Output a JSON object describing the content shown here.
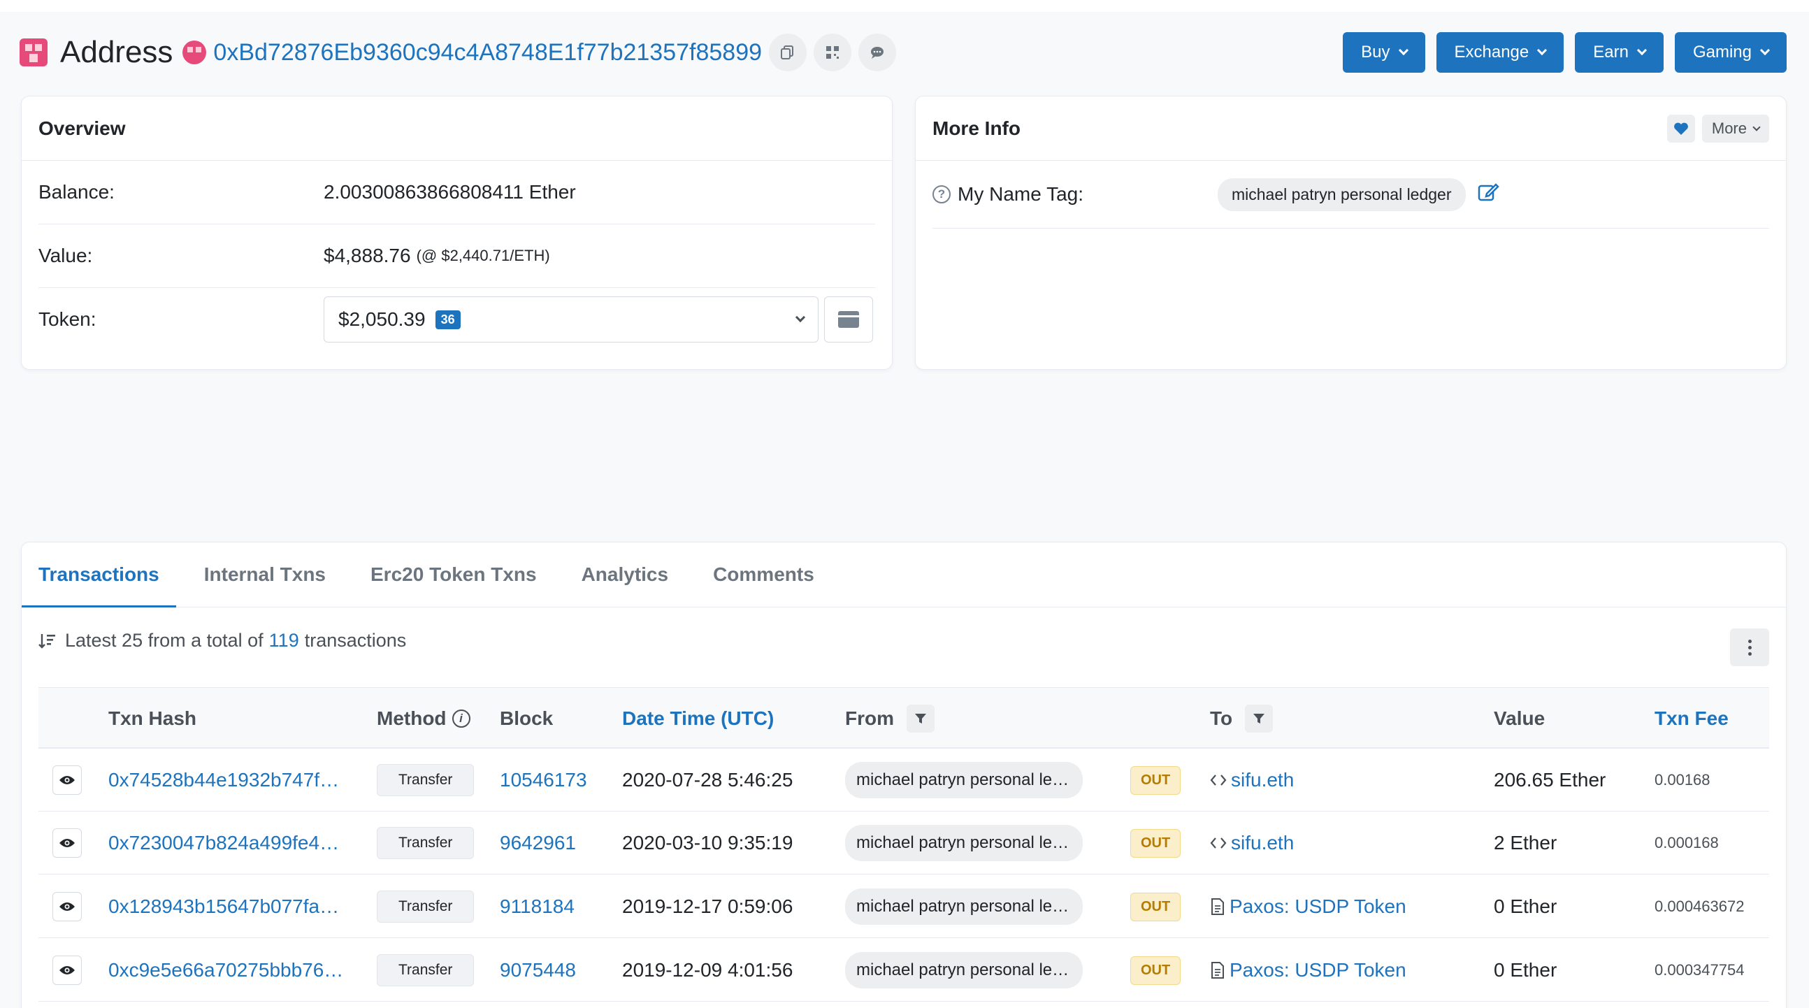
{
  "header": {
    "title": "Address",
    "address": "0xBd72876Eb9360c94c4A8748E1f77b21357f85899",
    "buttons": [
      {
        "label": "Buy"
      },
      {
        "label": "Exchange"
      },
      {
        "label": "Earn"
      },
      {
        "label": "Gaming"
      }
    ]
  },
  "overview": {
    "title": "Overview",
    "balance_label": "Balance:",
    "balance_value": "2.00300863866808411 Ether",
    "value_label": "Value:",
    "value_usd": "$4,888.76",
    "value_rate": "(@ $2,440.71/ETH)",
    "token_label": "Token:",
    "token_value": "$2,050.39",
    "token_count": "36"
  },
  "more_info": {
    "title": "More Info",
    "more_label": "More",
    "name_tag_label": "My Name Tag:",
    "name_tag_value": "michael patryn personal ledger"
  },
  "tabs": [
    "Transactions",
    "Internal Txns",
    "Erc20 Token Txns",
    "Analytics",
    "Comments"
  ],
  "summary": {
    "prefix": "Latest 25 from a total of",
    "count": "119",
    "suffix": "transactions"
  },
  "table": {
    "headers": {
      "hash": "Txn Hash",
      "method": "Method",
      "block": "Block",
      "datetime": "Date Time (UTC)",
      "from": "From",
      "to": "To",
      "value": "Value",
      "fee": "Txn Fee"
    },
    "rows": [
      {
        "hash": "0x74528b44e1932b747f…",
        "method": "Transfer",
        "block": "10546173",
        "datetime": "2020-07-28 5:46:25",
        "from": "michael patryn personal le…",
        "direction": "OUT",
        "to": "sifu.eth",
        "to_icon": "code-icon",
        "value": "206.65 Ether",
        "fee": "0.00168"
      },
      {
        "hash": "0x7230047b824a499fe4…",
        "method": "Transfer",
        "block": "9642961",
        "datetime": "2020-03-10 9:35:19",
        "from": "michael patryn personal le…",
        "direction": "OUT",
        "to": "sifu.eth",
        "to_icon": "code-icon",
        "value": "2 Ether",
        "fee": "0.000168"
      },
      {
        "hash": "0x128943b15647b077fa…",
        "method": "Transfer",
        "block": "9118184",
        "datetime": "2019-12-17 0:59:06",
        "from": "michael patryn personal le…",
        "direction": "OUT",
        "to": "Paxos: USDP Token",
        "to_icon": "file-icon",
        "value": "0 Ether",
        "fee": "0.000463672"
      },
      {
        "hash": "0xc9e5e66a70275bbb76…",
        "method": "Transfer",
        "block": "9075448",
        "datetime": "2019-12-09 4:01:56",
        "from": "michael patryn personal le…",
        "direction": "OUT",
        "to": "Paxos: USDP Token",
        "to_icon": "file-icon",
        "value": "0 Ether",
        "fee": "0.000347754"
      }
    ]
  },
  "colors": {
    "accent": "#1e73be",
    "out_badge_bg": "#fbeecb",
    "out_badge_text": "#b47d00",
    "logo": "#e64a7a"
  }
}
